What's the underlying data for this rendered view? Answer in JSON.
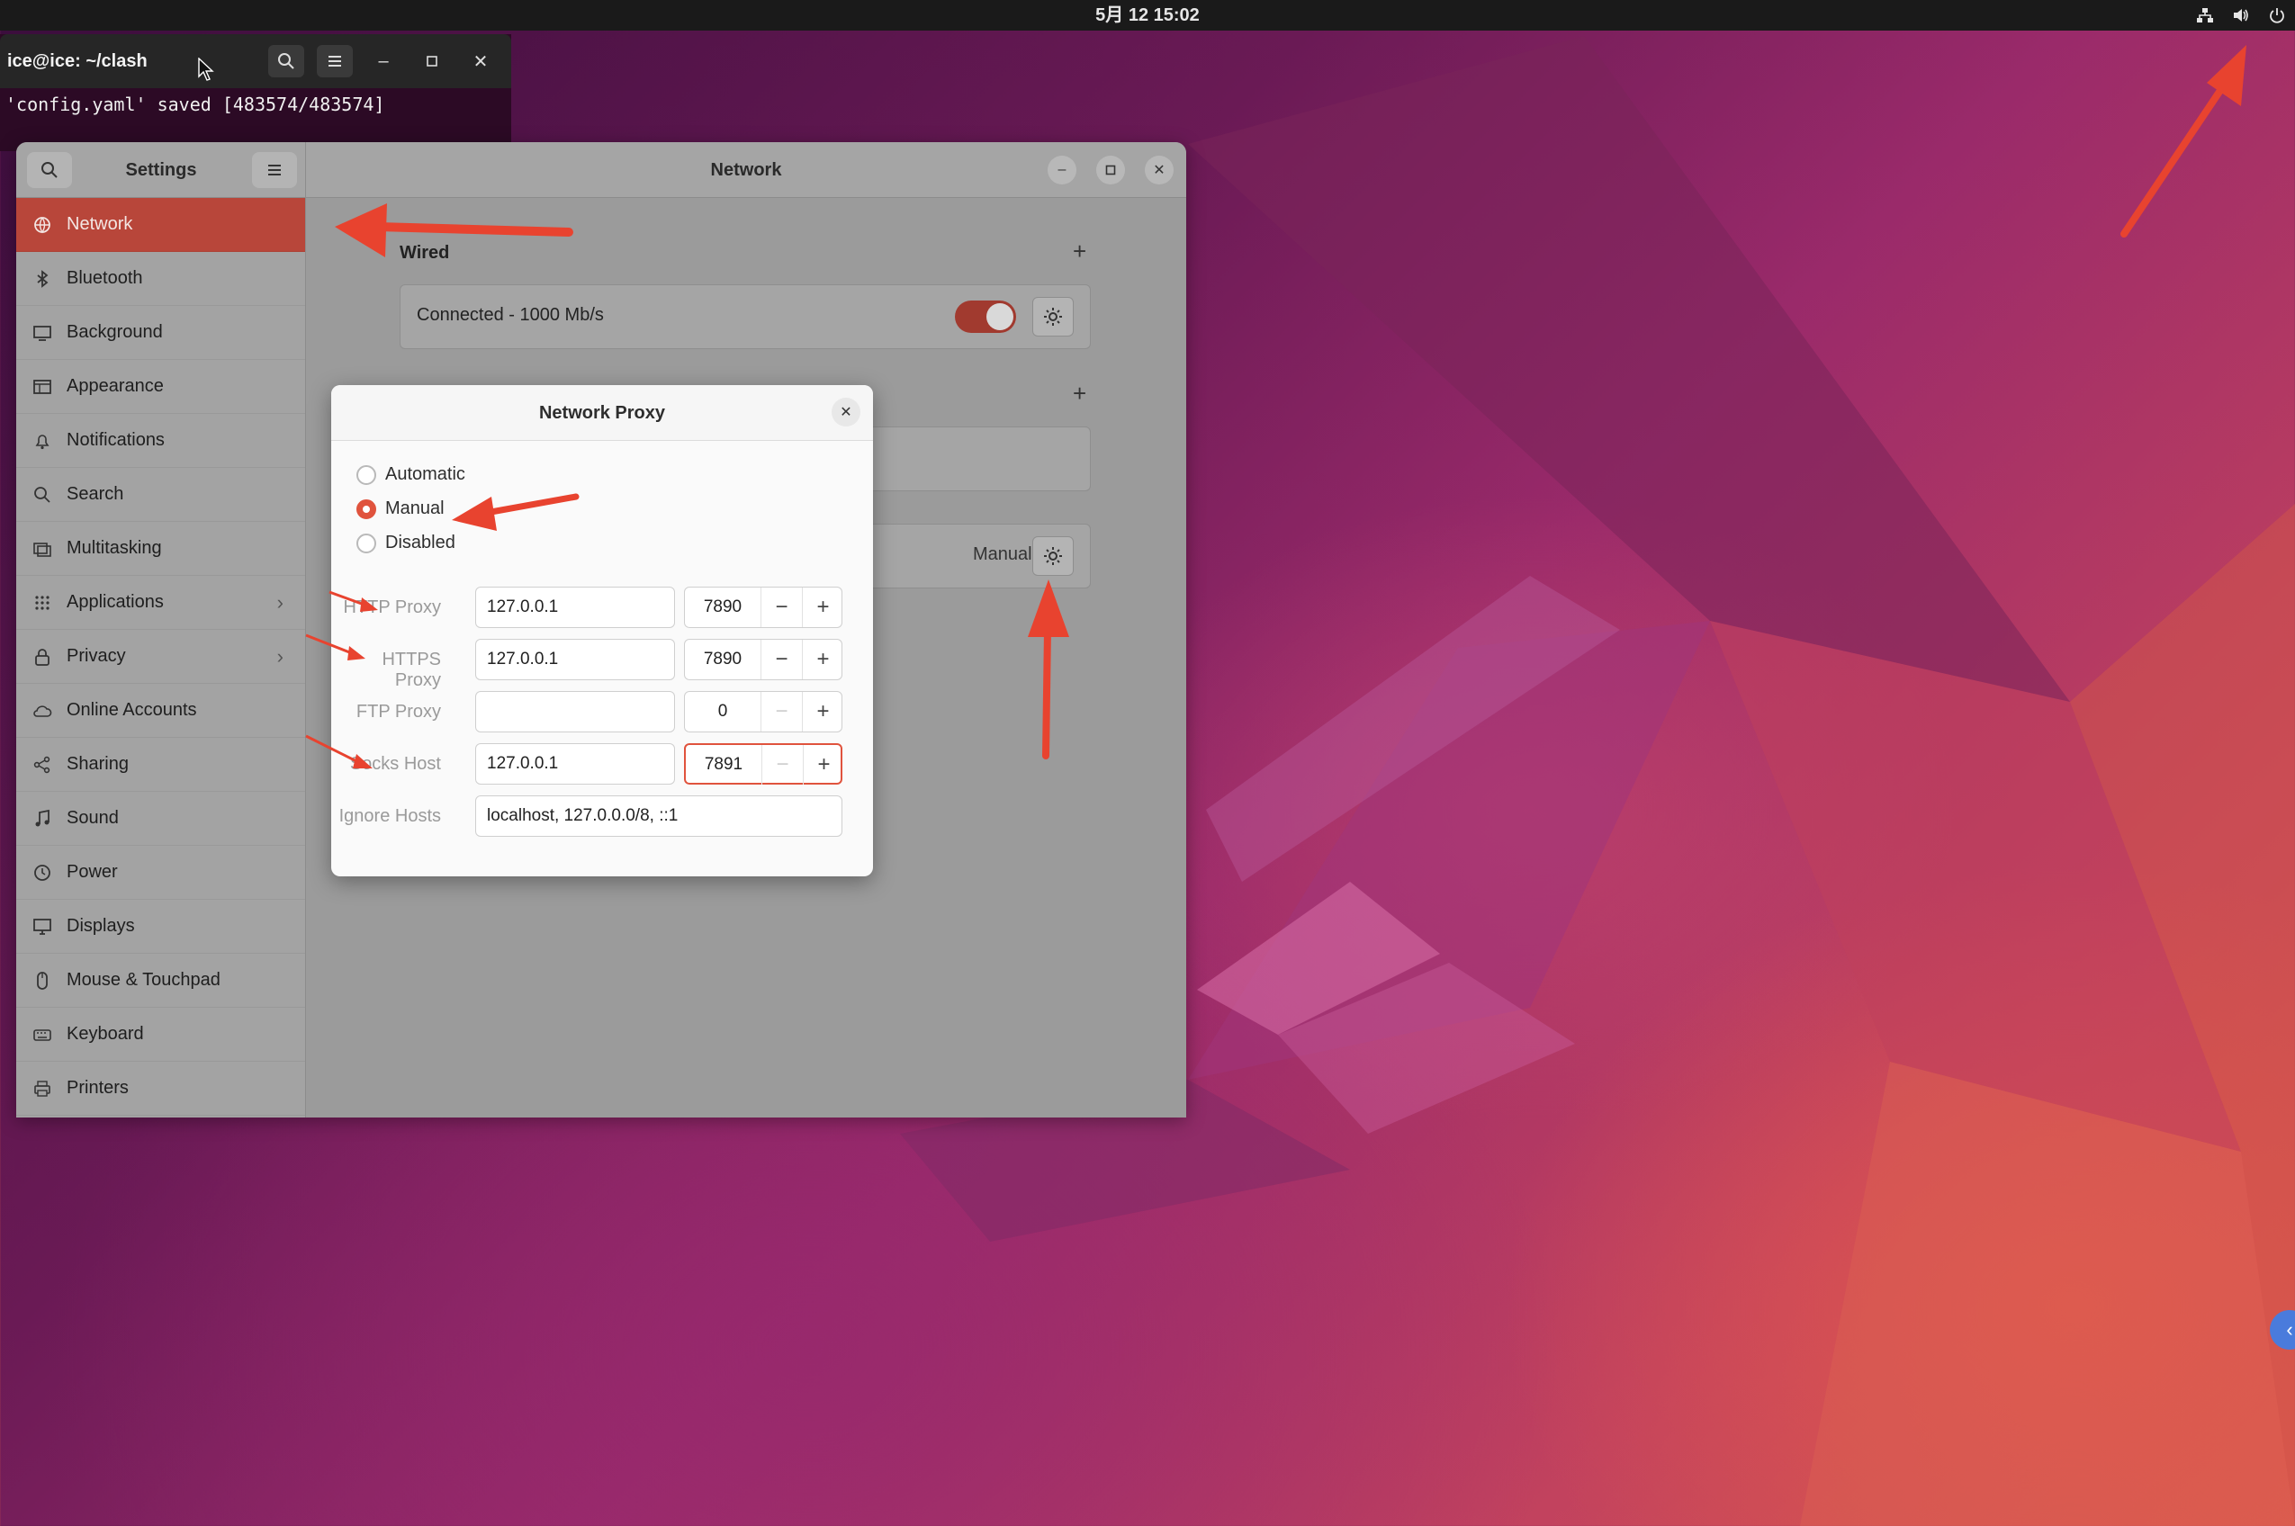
{
  "topbar": {
    "clock": "5月 12  15:02",
    "tray_icons": [
      "network-icon",
      "volume-icon",
      "power-icon"
    ]
  },
  "terminal": {
    "title": "ice@ice: ~/clash",
    "output_line": "'config.yaml' saved [483574/483574]"
  },
  "settings": {
    "sidebar_title": "Settings",
    "panel_title": "Network",
    "sidebar_items": [
      {
        "label": "Network",
        "icon": "network-icon",
        "active": true
      },
      {
        "label": "Bluetooth",
        "icon": "bluetooth-icon"
      },
      {
        "label": "Background",
        "icon": "background-icon"
      },
      {
        "label": "Appearance",
        "icon": "appearance-icon"
      },
      {
        "label": "Notifications",
        "icon": "bell-icon"
      },
      {
        "label": "Search",
        "icon": "search-icon"
      },
      {
        "label": "Multitasking",
        "icon": "multitasking-icon"
      },
      {
        "label": "Applications",
        "icon": "grid-icon",
        "chevron": true
      },
      {
        "label": "Privacy",
        "icon": "lock-icon",
        "chevron": true
      },
      {
        "label": "Online Accounts",
        "icon": "cloud-icon"
      },
      {
        "label": "Sharing",
        "icon": "share-icon"
      },
      {
        "label": "Sound",
        "icon": "music-icon"
      },
      {
        "label": "Power",
        "icon": "power-icon"
      },
      {
        "label": "Displays",
        "icon": "display-icon"
      },
      {
        "label": "Mouse & Touchpad",
        "icon": "mouse-icon"
      },
      {
        "label": "Keyboard",
        "icon": "keyboard-icon"
      },
      {
        "label": "Printers",
        "icon": "printer-icon"
      }
    ],
    "wired": {
      "section_title": "Wired",
      "status": "Connected - 1000 Mb/s",
      "enabled": true
    },
    "proxy_row": {
      "value": "Manual"
    }
  },
  "proxy_dialog": {
    "title": "Network Proxy",
    "modes": [
      "Automatic",
      "Manual",
      "Disabled"
    ],
    "selected_mode": "Manual",
    "fields": {
      "http": {
        "label": "HTTP Proxy",
        "host": "127.0.0.1",
        "port": "7890"
      },
      "https": {
        "label": "HTTPS Proxy",
        "host": "127.0.0.1",
        "port": "7890"
      },
      "ftp": {
        "label": "FTP Proxy",
        "host": "",
        "port": "0"
      },
      "socks": {
        "label": "Socks Host",
        "host": "127.0.0.1",
        "port": "7891"
      },
      "ignore": {
        "label": "Ignore Hosts",
        "value": "localhost, 127.0.0.0/8, ::1"
      }
    }
  },
  "colors": {
    "accent": "#e0533d",
    "annotation_arrow": "#e8432f",
    "active_sidebar": "#b8463a"
  }
}
